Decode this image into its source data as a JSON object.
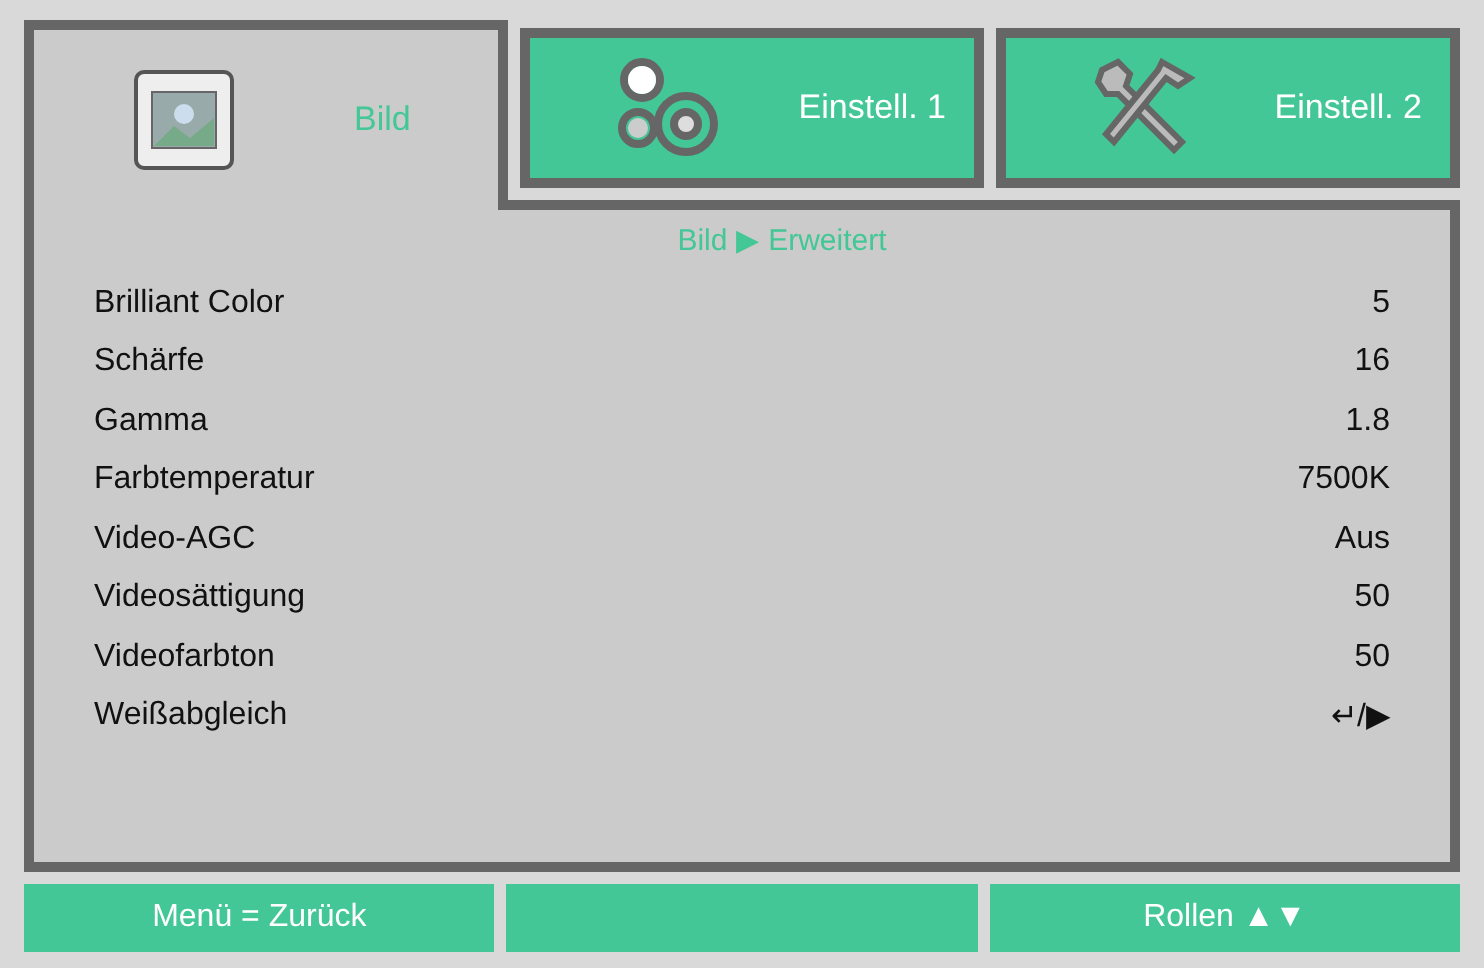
{
  "tabs": [
    {
      "label": "Bild",
      "selected": true,
      "kind": "picture"
    },
    {
      "label": "Einstell. 1",
      "selected": false,
      "kind": "gears"
    },
    {
      "label": "Einstell. 2",
      "selected": false,
      "kind": "tools"
    }
  ],
  "breadcrumb": {
    "parent": "Bild",
    "separator": "▶",
    "current": "Erweitert"
  },
  "rows": [
    {
      "label": "Brilliant Color",
      "value": "5"
    },
    {
      "label": "Schärfe",
      "value": "16"
    },
    {
      "label": "Gamma",
      "value": "1.8"
    },
    {
      "label": "Farbtemperatur",
      "value": "7500K"
    },
    {
      "label": "Video-AGC",
      "value": "Aus"
    },
    {
      "label": "Videosättigung",
      "value": "50"
    },
    {
      "label": "Videofarbton",
      "value": "50"
    },
    {
      "label": "Weißabgleich",
      "value": "↵/▶"
    }
  ],
  "footer": [
    {
      "kind": "hint",
      "text": "Menü = Zurück"
    },
    {
      "kind": "blank"
    },
    {
      "kind": "hint",
      "text": "Rollen ▲▼"
    }
  ]
}
